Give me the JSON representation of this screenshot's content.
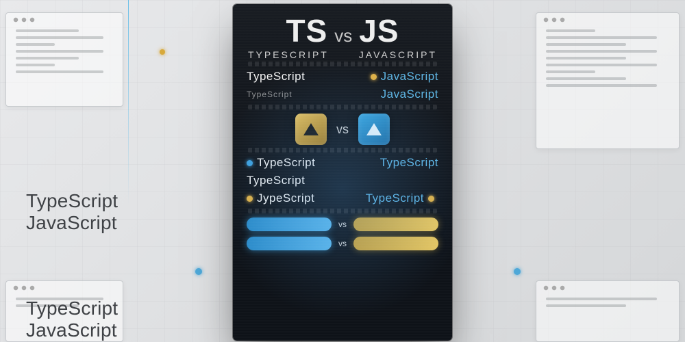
{
  "side_labels": {
    "ts": "TypeScript",
    "js": "JavaScript"
  },
  "box": {
    "left_abbr": "TS",
    "right_abbr": "JS",
    "vs": "vs",
    "left_full": "TYPESCRIPT",
    "right_full": "JAVASCRIPT",
    "rows_upper": [
      {
        "left": "TypeScript",
        "right": "JavaScript"
      },
      {
        "left": "TypeScript",
        "right": "JavaScript"
      }
    ],
    "center_vs": "vs",
    "rows_lower": [
      {
        "left": "TypeScript",
        "right": "TypeScript"
      },
      {
        "left": "TypeScript",
        "right": ""
      },
      {
        "left": "JypeScript",
        "right": "TypeScript"
      }
    ],
    "pill_vs": "vs"
  }
}
